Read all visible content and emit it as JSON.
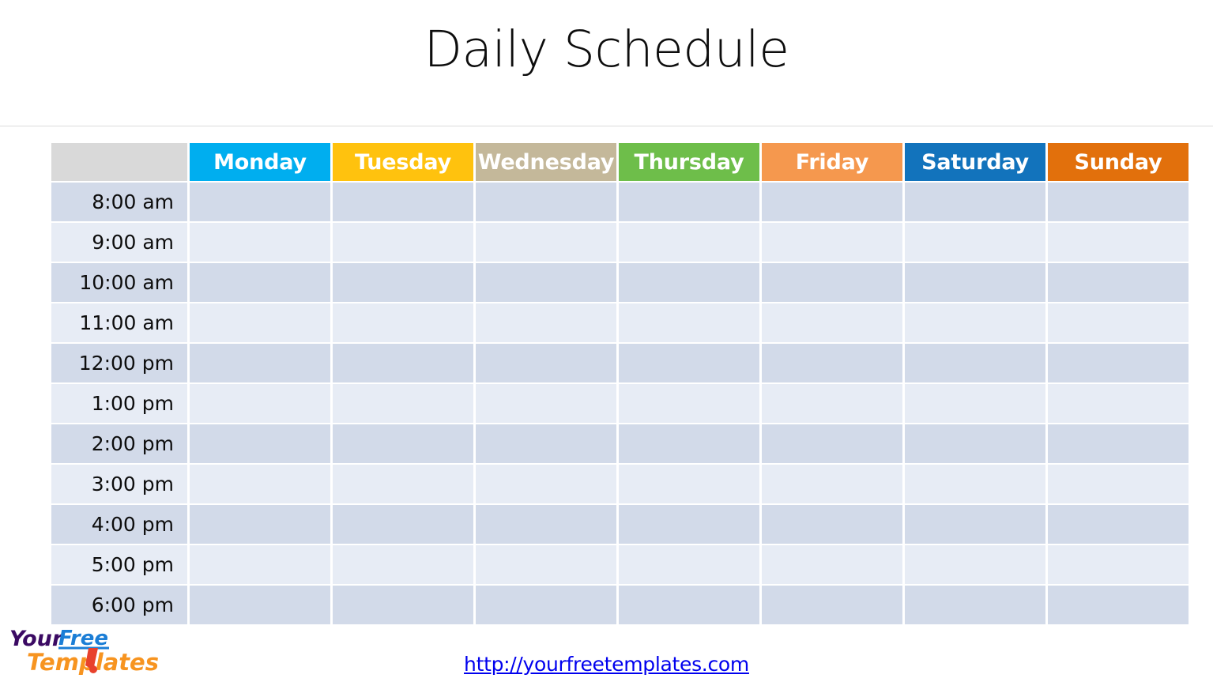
{
  "title": "Daily Schedule",
  "table": {
    "corner_label": "",
    "day_headers": [
      {
        "label": "Monday",
        "color": "#00aeef"
      },
      {
        "label": "Tuesday",
        "color": "#ffc20e"
      },
      {
        "label": "Wednesday",
        "color": "#c4b89a"
      },
      {
        "label": "Thursday",
        "color": "#6ebe4a"
      },
      {
        "label": "Friday",
        "color": "#f5984e"
      },
      {
        "label": "Saturday",
        "color": "#1273bc"
      },
      {
        "label": "Sunday",
        "color": "#e2700c"
      }
    ],
    "time_rows": [
      {
        "time": "8:00 am",
        "shade": "dark"
      },
      {
        "time": "9:00 am",
        "shade": "light"
      },
      {
        "time": "10:00 am",
        "shade": "dark"
      },
      {
        "time": "11:00 am",
        "shade": "light"
      },
      {
        "time": "12:00 pm",
        "shade": "dark"
      },
      {
        "time": "1:00 pm",
        "shade": "light"
      },
      {
        "time": "2:00 pm",
        "shade": "dark"
      },
      {
        "time": "3:00 pm",
        "shade": "light"
      },
      {
        "time": "4:00 pm",
        "shade": "dark"
      },
      {
        "time": "5:00 pm",
        "shade": "light"
      },
      {
        "time": "6:00 pm",
        "shade": "dark"
      }
    ],
    "row_color_dark": "#d2dae9",
    "row_color_light": "#e7ecf5",
    "corner_color": "#d9d9d9"
  },
  "footer": {
    "url_text": "http://yourfreetemplates.com",
    "url_color": "#0000ee"
  },
  "logo": {
    "word_your": "Your",
    "word_free": "Free",
    "word_templates": "Templates",
    "color_your": "#3b0a63",
    "color_free": "#1b7ed6",
    "color_templates": "#f79420",
    "color_accent": "#e8412c"
  }
}
